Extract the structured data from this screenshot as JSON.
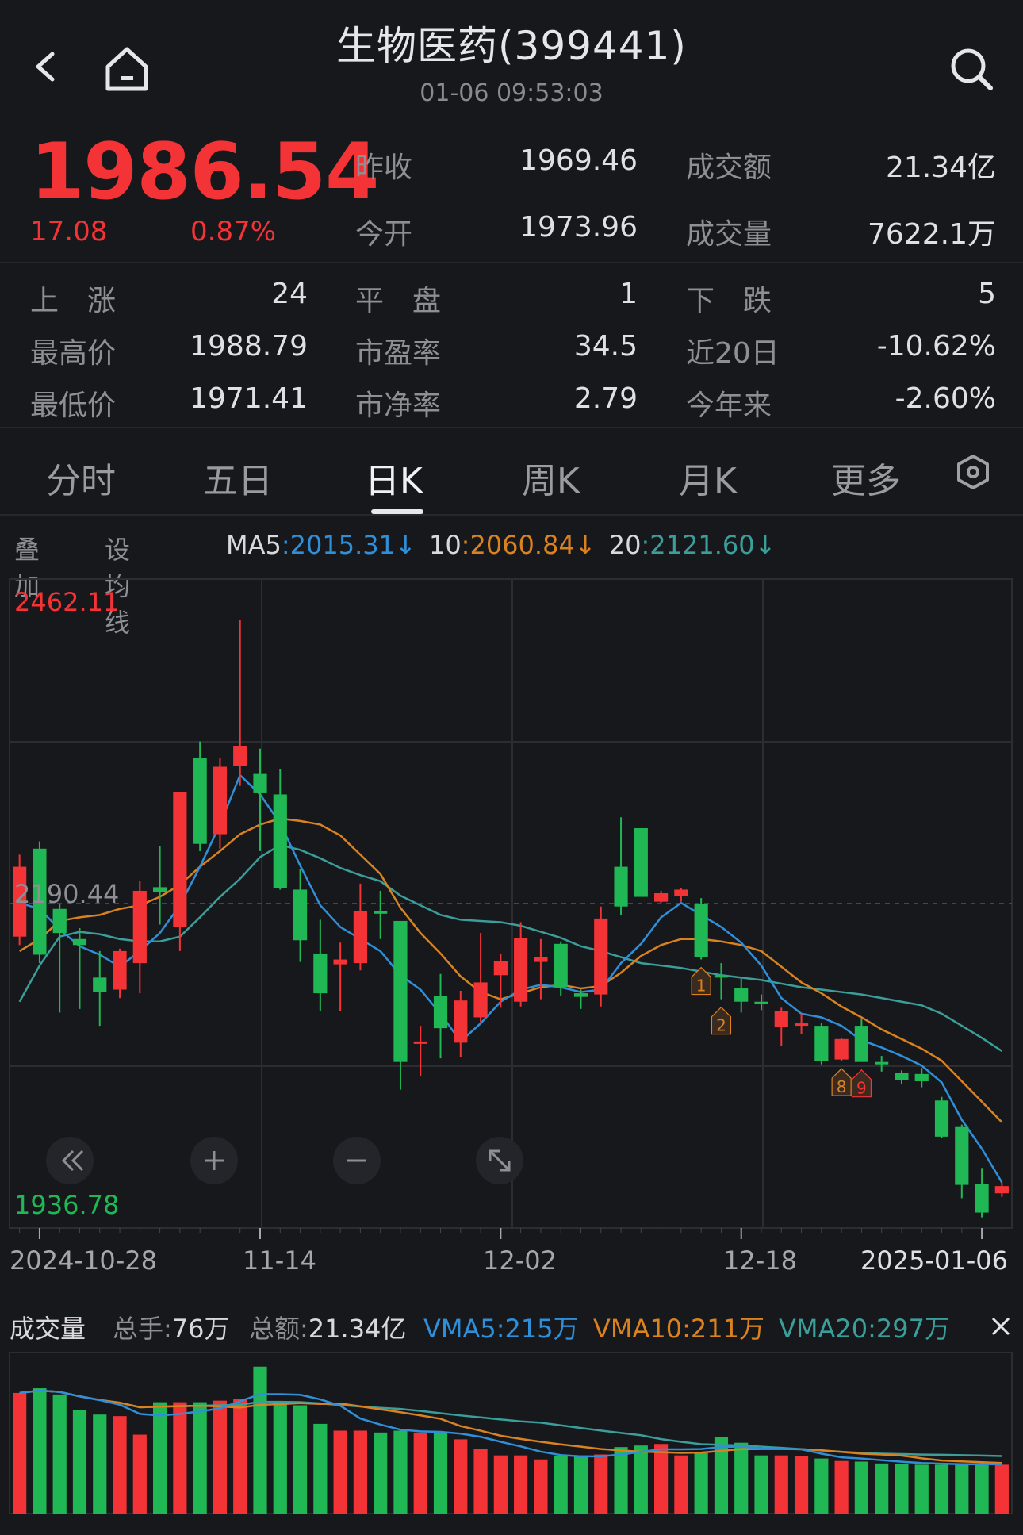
{
  "header": {
    "title": "生物医药(399441)",
    "time": "01-06 09:53:03"
  },
  "quote": {
    "price": "1986.54",
    "change": "17.08",
    "change_pct": "0.87%",
    "prev_close_label": "昨收",
    "prev_close": "1969.46",
    "open_label": "今开",
    "open": "1973.96",
    "amount_label": "成交额",
    "amount": "21.34亿",
    "volume_label": "成交量",
    "volume": "7622.1万"
  },
  "stats": {
    "up_label": "上　涨",
    "up": "24",
    "flat_label": "平　盘",
    "flat": "1",
    "down_label": "下　跌",
    "down": "5",
    "high_label": "最高价",
    "high": "1988.79",
    "pe_label": "市盈率",
    "pe": "34.5",
    "d20_label": "近20日",
    "d20": "-10.62%",
    "low_label": "最低价",
    "low": "1971.41",
    "pb_label": "市净率",
    "pb": "2.79",
    "ytd_label": "今年来",
    "ytd": "-2.60%"
  },
  "tabs": [
    "分时",
    "五日",
    "日K",
    "周K",
    "月K",
    "更多"
  ],
  "active_tab": "日K",
  "ma_bar": {
    "overlay": "叠加",
    "set_ma": "设均线",
    "ma5_label": "MA5",
    "ma5": "2015.31",
    "ma10_label": "10",
    "ma10": "2060.84",
    "ma20_label": "20",
    "ma20": "2121.60",
    "arrow": "↓"
  },
  "colors": {
    "up": "#f43336",
    "down": "#1fb854",
    "ma5": "#2f8fd8",
    "ma10": "#d9821f",
    "ma20": "#3a9e9a",
    "bg": "#17181c"
  },
  "chart_data": {
    "type": "candlestick",
    "ymax_label": "2462.11",
    "ymin_label": "1936.78",
    "ref_label": "2190.44",
    "ylim": [
      1936.78,
      2462.11
    ],
    "x_labels": [
      "2024-10-28",
      "11-14",
      "12-02",
      "12-18",
      "2025-01-06"
    ],
    "x_label_index": [
      1,
      12,
      24,
      36,
      48
    ],
    "candles": [
      {
        "o": 2230,
        "h": 2240,
        "l": 2165,
        "c": 2172,
        "d": "up"
      },
      {
        "o": 2245,
        "h": 2251,
        "l": 2150,
        "c": 2157,
        "d": "dn"
      },
      {
        "o": 2195,
        "h": 2199,
        "l": 2109,
        "c": 2175,
        "d": "dn"
      },
      {
        "o": 2170,
        "h": 2179,
        "l": 2112,
        "c": 2165,
        "d": "dn"
      },
      {
        "o": 2138,
        "h": 2160,
        "l": 2098,
        "c": 2126,
        "d": "dn"
      },
      {
        "o": 2128,
        "h": 2162,
        "l": 2121,
        "c": 2160,
        "d": "up"
      },
      {
        "o": 2150,
        "h": 2218,
        "l": 2125,
        "c": 2210,
        "d": "up"
      },
      {
        "o": 2213,
        "h": 2247,
        "l": 2182,
        "c": 2209,
        "d": "dn"
      },
      {
        "o": 2180,
        "h": 2290,
        "l": 2160,
        "c": 2292,
        "d": "up"
      },
      {
        "o": 2320,
        "h": 2334,
        "l": 2243,
        "c": 2249,
        "d": "dn"
      },
      {
        "o": 2257,
        "h": 2320,
        "l": 2245,
        "c": 2313,
        "d": "up"
      },
      {
        "o": 2314,
        "h": 2435,
        "l": 2297,
        "c": 2330,
        "d": "up"
      },
      {
        "o": 2307,
        "h": 2328,
        "l": 2243,
        "c": 2291,
        "d": "dn"
      },
      {
        "o": 2290,
        "h": 2311,
        "l": 2211,
        "c": 2212,
        "d": "dn"
      },
      {
        "o": 2211,
        "h": 2228,
        "l": 2151,
        "c": 2169,
        "d": "dn"
      },
      {
        "o": 2158,
        "h": 2186,
        "l": 2110,
        "c": 2125,
        "d": "dn"
      },
      {
        "o": 2153,
        "h": 2167,
        "l": 2110,
        "c": 2149,
        "d": "up"
      },
      {
        "o": 2150,
        "h": 2216,
        "l": 2144,
        "c": 2193,
        "d": "up"
      },
      {
        "o": 2193,
        "h": 2210,
        "l": 2170,
        "c": 2191,
        "d": "dn"
      },
      {
        "o": 2185,
        "h": 2185,
        "l": 2045,
        "c": 2068,
        "d": "dn"
      },
      {
        "o": 2085,
        "h": 2098,
        "l": 2056,
        "c": 2083,
        "d": "up"
      },
      {
        "o": 2123,
        "h": 2141,
        "l": 2071,
        "c": 2096,
        "d": "dn"
      },
      {
        "o": 2084,
        "h": 2127,
        "l": 2072,
        "c": 2119,
        "d": "up"
      },
      {
        "o": 2105,
        "h": 2175,
        "l": 2101,
        "c": 2134,
        "d": "up"
      },
      {
        "o": 2140,
        "h": 2158,
        "l": 2113,
        "c": 2152,
        "d": "up"
      },
      {
        "o": 2118,
        "h": 2184,
        "l": 2114,
        "c": 2171,
        "d": "up"
      },
      {
        "o": 2151,
        "h": 2170,
        "l": 2120,
        "c": 2155,
        "d": "up"
      },
      {
        "o": 2166,
        "h": 2168,
        "l": 2123,
        "c": 2130,
        "d": "dn"
      },
      {
        "o": 2125,
        "h": 2128,
        "l": 2112,
        "c": 2122,
        "d": "dn"
      },
      {
        "o": 2124,
        "h": 2197,
        "l": 2114,
        "c": 2187,
        "d": "up"
      },
      {
        "o": 2230,
        "h": 2271,
        "l": 2190,
        "c": 2197,
        "d": "dn"
      },
      {
        "o": 2262,
        "h": 2258,
        "l": 2209,
        "c": 2205,
        "d": "dn"
      },
      {
        "o": 2201,
        "h": 2210,
        "l": 2200,
        "c": 2208,
        "d": "up"
      },
      {
        "o": 2206,
        "h": 2212,
        "l": 2201,
        "c": 2211,
        "d": "up"
      },
      {
        "o": 2199,
        "h": 2204,
        "l": 2153,
        "c": 2155,
        "d": "dn"
      },
      {
        "o": 2140,
        "h": 2150,
        "l": 2120,
        "c": 2138,
        "d": "dn"
      },
      {
        "o": 2118,
        "h": 2137,
        "l": 2109,
        "c": 2129,
        "d": "dn"
      },
      {
        "o": 2117,
        "h": 2124,
        "l": 2111,
        "c": 2118,
        "d": "dn"
      },
      {
        "o": 2097,
        "h": 2113,
        "l": 2081,
        "c": 2110,
        "d": "up"
      },
      {
        "o": 2099,
        "h": 2108,
        "l": 2091,
        "c": 2100,
        "d": "up"
      },
      {
        "o": 2098,
        "h": 2100,
        "l": 2066,
        "c": 2069,
        "d": "dn"
      },
      {
        "o": 2070,
        "h": 2088,
        "l": 2069,
        "c": 2087,
        "d": "up"
      },
      {
        "o": 2068,
        "h": 2104,
        "l": 2068,
        "c": 2098,
        "d": "dn"
      },
      {
        "o": 2066,
        "h": 2073,
        "l": 2060,
        "c": 2068,
        "d": "dn"
      },
      {
        "o": 2059,
        "h": 2061,
        "l": 2050,
        "c": 2053,
        "d": "dn"
      },
      {
        "o": 2058,
        "h": 2063,
        "l": 2047,
        "c": 2052,
        "d": "dn"
      },
      {
        "o": 2036,
        "h": 2039,
        "l": 2005,
        "c": 2006,
        "d": "dn"
      },
      {
        "o": 2014,
        "h": 2016,
        "l": 1955,
        "c": 1966,
        "d": "dn"
      },
      {
        "o": 1967,
        "h": 1980,
        "l": 1939,
        "c": 1943,
        "d": "dn"
      },
      {
        "o": 1965,
        "h": 1968,
        "l": 1956,
        "c": 1959,
        "d": "up"
      }
    ],
    "ma5": [
      2200,
      2195,
      2178,
      2164,
      2157,
      2147,
      2160,
      2175,
      2198,
      2230,
      2265,
      2306,
      2290,
      2266,
      2231,
      2198,
      2180,
      2170,
      2160,
      2140,
      2128,
      2108,
      2085,
      2100,
      2118,
      2128,
      2132,
      2130,
      2126,
      2128,
      2150,
      2166,
      2188,
      2200,
      2190,
      2180,
      2167,
      2148,
      2121,
      2108,
      2105,
      2098,
      2086,
      2080,
      2073,
      2065,
      2051,
      2020,
      1996,
      1968
    ],
    "ma10": [
      2160,
      2170,
      2185,
      2188,
      2190,
      2195,
      2198,
      2205,
      2215,
      2230,
      2243,
      2257,
      2265,
      2270,
      2268,
      2265,
      2256,
      2240,
      2224,
      2196,
      2175,
      2158,
      2139,
      2126,
      2120,
      2125,
      2130,
      2132,
      2129,
      2131,
      2142,
      2156,
      2165,
      2170,
      2170,
      2168,
      2165,
      2160,
      2147,
      2134,
      2125,
      2114,
      2105,
      2095,
      2087,
      2079,
      2069,
      2052,
      2035,
      2018
    ],
    "ma20": [
      2118,
      2148,
      2172,
      2176,
      2174,
      2170,
      2168,
      2168,
      2172,
      2188,
      2205,
      2220,
      2238,
      2248,
      2244,
      2237,
      2229,
      2223,
      2218,
      2206,
      2198,
      2190,
      2186,
      2185,
      2184,
      2181,
      2176,
      2171,
      2164,
      2160,
      2155,
      2150,
      2148,
      2146,
      2143,
      2140,
      2138,
      2136,
      2133,
      2130,
      2128,
      2126,
      2124,
      2121,
      2118,
      2115,
      2108,
      2098,
      2088,
      2077
    ],
    "markers": [
      {
        "index": 34,
        "label": "1",
        "color": "#d9821f"
      },
      {
        "index": 35,
        "label": "2",
        "color": "#d9821f"
      },
      {
        "index": 41,
        "label": "8",
        "color": "#d9821f"
      },
      {
        "index": 42,
        "label": "9",
        "color": "#f43336"
      }
    ]
  },
  "volume": {
    "title": "成交量",
    "total_hand_label": "总手:",
    "total_hand": "76万",
    "total_amount_label": "总额:",
    "total_amount": "21.34亿",
    "vma5_label": "VMA5:",
    "vma5": "215万",
    "vma10_label": "VMA10:",
    "vma10": "211万",
    "vma20_label": "VMA20:",
    "vma20": "297万",
    "values": [
      390,
      405,
      385,
      335,
      320,
      315,
      255,
      360,
      360,
      360,
      365,
      370,
      475,
      360,
      350,
      290,
      268,
      268,
      262,
      268,
      262,
      260,
      240,
      210,
      188,
      188,
      175,
      185,
      188,
      191,
      215,
      220,
      225,
      188,
      195,
      248,
      229,
      188,
      188,
      185,
      178,
      170,
      168,
      162,
      160,
      158,
      158,
      160,
      162,
      158
    ],
    "ymax": 500
  }
}
